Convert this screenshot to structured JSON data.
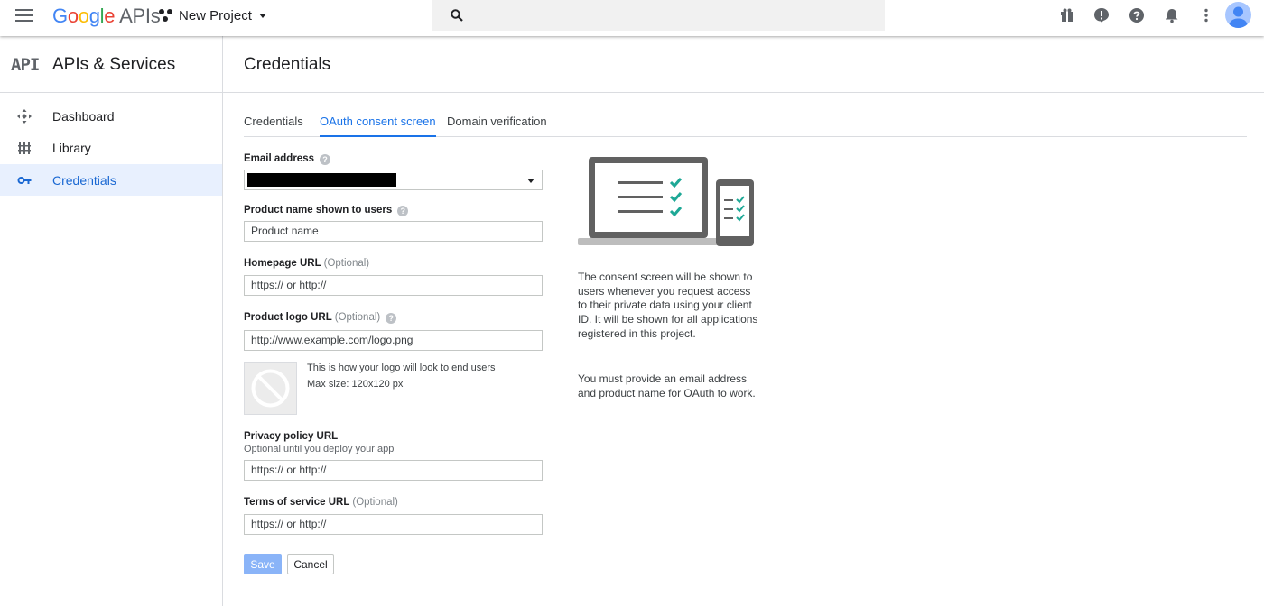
{
  "topbar": {
    "logo_google_letters": [
      "G",
      "o",
      "o",
      "g",
      "l",
      "e"
    ],
    "logo_apis": "APIs",
    "project_name": "New Project",
    "icons": [
      "menu-icon",
      "search-icon",
      "gift-icon",
      "feedback-icon",
      "help-icon",
      "notifications-icon",
      "more-vert-icon",
      "avatar"
    ]
  },
  "sidebar": {
    "badge": "API",
    "title": "APIs & Services",
    "items": [
      {
        "label": "Dashboard",
        "icon": "dashboard-icon"
      },
      {
        "label": "Library",
        "icon": "library-icon"
      },
      {
        "label": "Credentials",
        "icon": "key-icon",
        "active": true
      }
    ]
  },
  "main": {
    "title": "Credentials",
    "tabs": [
      {
        "label": "Credentials"
      },
      {
        "label": "OAuth consent screen",
        "active": true
      },
      {
        "label": "Domain verification"
      }
    ]
  },
  "form": {
    "email_label": "Email address",
    "product_label": "Product name shown to users",
    "product_placeholder": "Product name",
    "homepage_label": "Homepage URL",
    "optional": "(Optional)",
    "homepage_placeholder": "https:// or http://",
    "logo_label": "Product logo URL",
    "logo_placeholder": "http://www.example.com/logo.png",
    "logo_note_1": "This is how your logo will look to end users",
    "logo_note_2": "Max size: 120x120 px",
    "privacy_label": "Privacy policy URL",
    "privacy_sub": "Optional until you deploy your app",
    "privacy_placeholder": "https:// or http://",
    "tos_label": "Terms of service URL",
    "tos_placeholder": "https:// or http://",
    "save": "Save",
    "cancel": "Cancel"
  },
  "info": {
    "paragraph1": "The consent screen will be shown to users whenever you request access to their private data using your client ID. It will be shown for all applications registered in this project.",
    "paragraph2": "You must provide an email address and product name for OAuth to work."
  },
  "colors": {
    "accent": "#1a73e8",
    "active_bg": "#e8f0fe",
    "check_teal": "#1ea896",
    "save_disabled": "#8ab4f8"
  }
}
